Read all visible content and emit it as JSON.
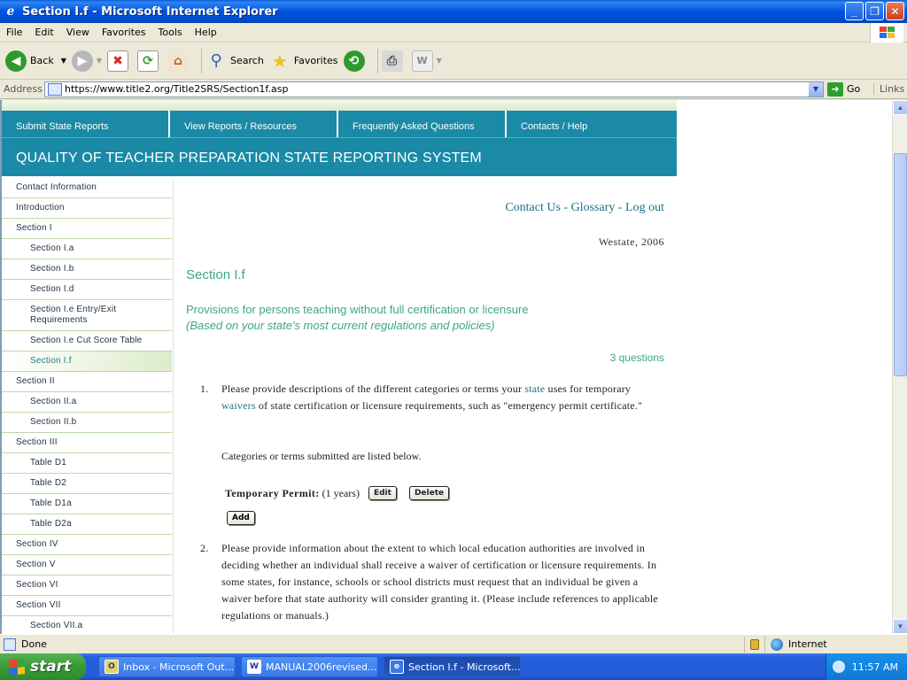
{
  "window": {
    "title": "Section I.f - Microsoft Internet Explorer"
  },
  "menu": [
    "File",
    "Edit",
    "View",
    "Favorites",
    "Tools",
    "Help"
  ],
  "toolbar": {
    "back": "Back",
    "search": "Search",
    "favorites": "Favorites"
  },
  "address": {
    "label": "Address",
    "url": "https://www.title2.org/Title2SRS/Section1f.asp",
    "go": "Go",
    "links": "Links"
  },
  "nav": [
    "Submit State Reports",
    "View Reports / Resources",
    "Frequently Asked Questions",
    "Contacts / Help"
  ],
  "banner": "QUALITY OF TEACHER PREPARATION STATE REPORTING SYSTEM",
  "sidebar": [
    {
      "label": "Contact Information",
      "sub": false
    },
    {
      "label": "Introduction",
      "sub": false
    },
    {
      "label": "Section I",
      "sub": false
    },
    {
      "label": "Section I.a",
      "sub": true
    },
    {
      "label": "Section I.b",
      "sub": true
    },
    {
      "label": "Section I.d",
      "sub": true
    },
    {
      "label": "Section I.e Entry/Exit Requirements",
      "sub": true
    },
    {
      "label": "Section I.e Cut Score Table",
      "sub": true
    },
    {
      "label": "Section I.f",
      "sub": true,
      "active": true
    },
    {
      "label": "Section II",
      "sub": false
    },
    {
      "label": "Section II.a",
      "sub": true
    },
    {
      "label": "Section II.b",
      "sub": true
    },
    {
      "label": "Section III",
      "sub": false
    },
    {
      "label": "Table D1",
      "sub": true
    },
    {
      "label": "Table D2",
      "sub": true
    },
    {
      "label": "Table D1a",
      "sub": true
    },
    {
      "label": "Table D2a",
      "sub": true
    },
    {
      "label": "Section IV",
      "sub": false
    },
    {
      "label": "Section V",
      "sub": false
    },
    {
      "label": "Section VI",
      "sub": false
    },
    {
      "label": "Section VII",
      "sub": false
    },
    {
      "label": "Section VII.a",
      "sub": true
    }
  ],
  "content": {
    "contact": "Contact Us",
    "glossary": "Glossary",
    "logout": "Log out",
    "state_year": "Westate, 2006",
    "section_title": "Section I.f",
    "provision_title": "Provisions for persons teaching without full certification or licensure",
    "provision_sub": "(Based on your state's most current regulations and policies)",
    "question_count": "3 questions",
    "q1": {
      "num": "1.",
      "p1": "Please provide descriptions of the different categories or terms your ",
      "kw1": "state",
      "p2": " uses for temporary ",
      "kw2": "waivers",
      "p3": " of state certification or licensure requirements, such as \"emergency permit certificate.\""
    },
    "submitted_note": "Categories or terms submitted are listed below.",
    "permit": {
      "name": "Temporary Permit:",
      "duration": "(1 years)",
      "edit": "Edit",
      "delete": "Delete",
      "add": "Add"
    },
    "q2": {
      "num": "2.",
      "text": "Please provide information about the extent to which local education authorities are involved in deciding whether an individual shall receive a waiver of certification or licensure requirements. In some states, for instance, schools or school districts must request that an individual be given a waiver before that state authority will consider granting it. (Please include references to applicable regulations or manuals.)"
    }
  },
  "status": {
    "text": "Done",
    "zone": "Internet"
  },
  "taskbar": {
    "start": "start",
    "tasks": [
      "Inbox - Microsoft Out...",
      "MANUAL2006revised....",
      "Section I.f - Microsoft..."
    ],
    "clock": "11:57 AM"
  }
}
